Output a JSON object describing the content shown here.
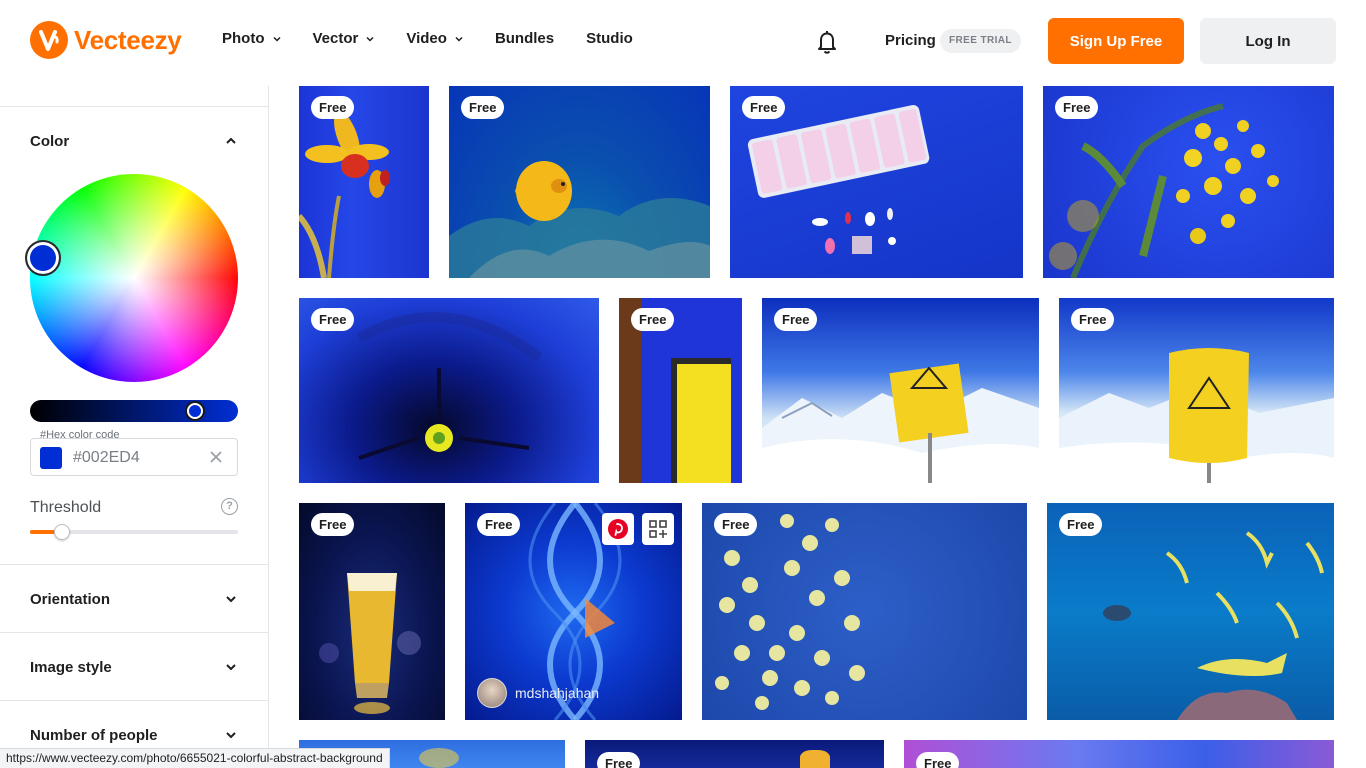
{
  "header": {
    "brand": "Vecteezy",
    "nav": [
      {
        "label": "Photo",
        "has_dropdown": true
      },
      {
        "label": "Vector",
        "has_dropdown": true
      },
      {
        "label": "Video",
        "has_dropdown": true
      },
      {
        "label": "Bundles",
        "has_dropdown": false
      },
      {
        "label": "Studio",
        "has_dropdown": false
      }
    ],
    "pricing_label": "Pricing",
    "trial_badge": "FREE TRIAL",
    "signup_label": "Sign Up Free",
    "login_label": "Log In",
    "accent_color": "#ff7000"
  },
  "sidebar": {
    "color_section": {
      "title": "Color",
      "expanded": true,
      "hex_label": "#Hex color code",
      "hex_value": "#002ED4",
      "selected_color": "#002ED4",
      "threshold_label": "Threshold",
      "threshold_value": 0.12
    },
    "orientation_title": "Orientation",
    "image_style_title": "Image style",
    "people_title": "Number of people"
  },
  "gallery": {
    "badge_label": "Free",
    "hovered_author": "mdshahjahan"
  },
  "status_bar": {
    "url": "https://www.vecteezy.com/photo/6655021-colorful-abstract-background"
  }
}
